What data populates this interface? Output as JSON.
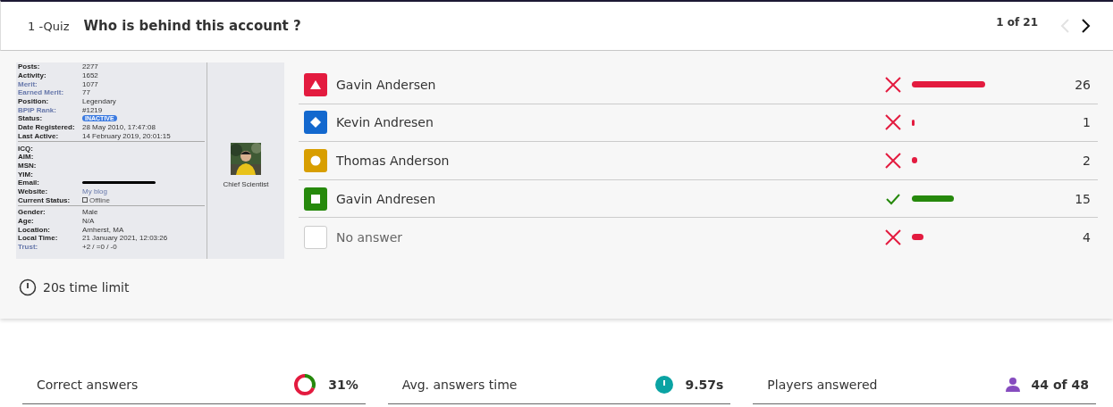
{
  "header": {
    "quiz_label": "1 -Quiz",
    "question": "Who is behind this account ?",
    "counter": "1 of 21",
    "prev": {
      "disabled": true
    },
    "next": {
      "disabled": false
    }
  },
  "profile": {
    "sections": [
      [
        {
          "label": "Posts:",
          "value": "2277",
          "link": false
        },
        {
          "label": "Activity:",
          "value": "1652",
          "link": false
        },
        {
          "label": "Merit:",
          "value": "1077",
          "link": true
        },
        {
          "label": "Earned Merit:",
          "value": "77",
          "link": true
        },
        {
          "label": "Position:",
          "value": "Legendary",
          "link": false
        },
        {
          "label": "BPIP Rank:",
          "value": "#1219",
          "link": true
        },
        {
          "label": "Status:",
          "value": "INACTIVE",
          "link": false,
          "kind": "badge"
        },
        {
          "label": "Date Registered:",
          "value": "28 May 2010, 17:47:08",
          "link": false
        },
        {
          "label": "Last Active:",
          "value": "14 February 2019, 20:01:15",
          "link": false
        }
      ],
      [
        {
          "label": "ICQ:",
          "link": false
        },
        {
          "label": "AIM:",
          "link": false
        },
        {
          "label": "MSN:",
          "link": false
        },
        {
          "label": "YIM:",
          "link": false
        },
        {
          "label": "Email:",
          "link": false,
          "kind": "redacted"
        },
        {
          "label": "Website:",
          "value": "My blog",
          "link": false,
          "kind": "link"
        },
        {
          "label": "Current Status:",
          "value": "Offline",
          "link": false,
          "kind": "status"
        }
      ],
      [
        {
          "label": "Gender:",
          "value": "Male",
          "link": false
        },
        {
          "label": "Age:",
          "value": "N/A",
          "link": false
        },
        {
          "label": "Location:",
          "value": "Amherst, MA",
          "link": false
        },
        {
          "label": "Local Time:",
          "value": "21 January 2021, 12:03:26",
          "link": false
        },
        {
          "label": "Trust:",
          "value": "+2 / =0 / -0",
          "link": true
        }
      ]
    ],
    "role": "Chief Scientist"
  },
  "time_limit": "20s time limit",
  "answers": [
    {
      "kind": "triangle",
      "color": "#e31b3f",
      "text": "Gavin Andersen",
      "correct": false,
      "count": "26"
    },
    {
      "kind": "diamond",
      "color": "#1368ce",
      "text": "Kevin Andresen",
      "correct": false,
      "count": "1"
    },
    {
      "kind": "circle",
      "color": "#d89e00",
      "text": "Thomas Anderson",
      "correct": false,
      "count": "2"
    },
    {
      "kind": "square",
      "color": "#26890c",
      "text": "Gavin Andresen",
      "correct": true,
      "count": "15"
    },
    {
      "kind": "none",
      "text": "No answer",
      "correct": false,
      "count": "4"
    }
  ],
  "stats": [
    {
      "kind": "donut",
      "label": "Correct answers",
      "value": "31%"
    },
    {
      "kind": "clock",
      "label": "Avg. answers time",
      "value": "9.57s"
    },
    {
      "kind": "person",
      "label": "Players answered",
      "value": "44 of 48"
    }
  ]
}
